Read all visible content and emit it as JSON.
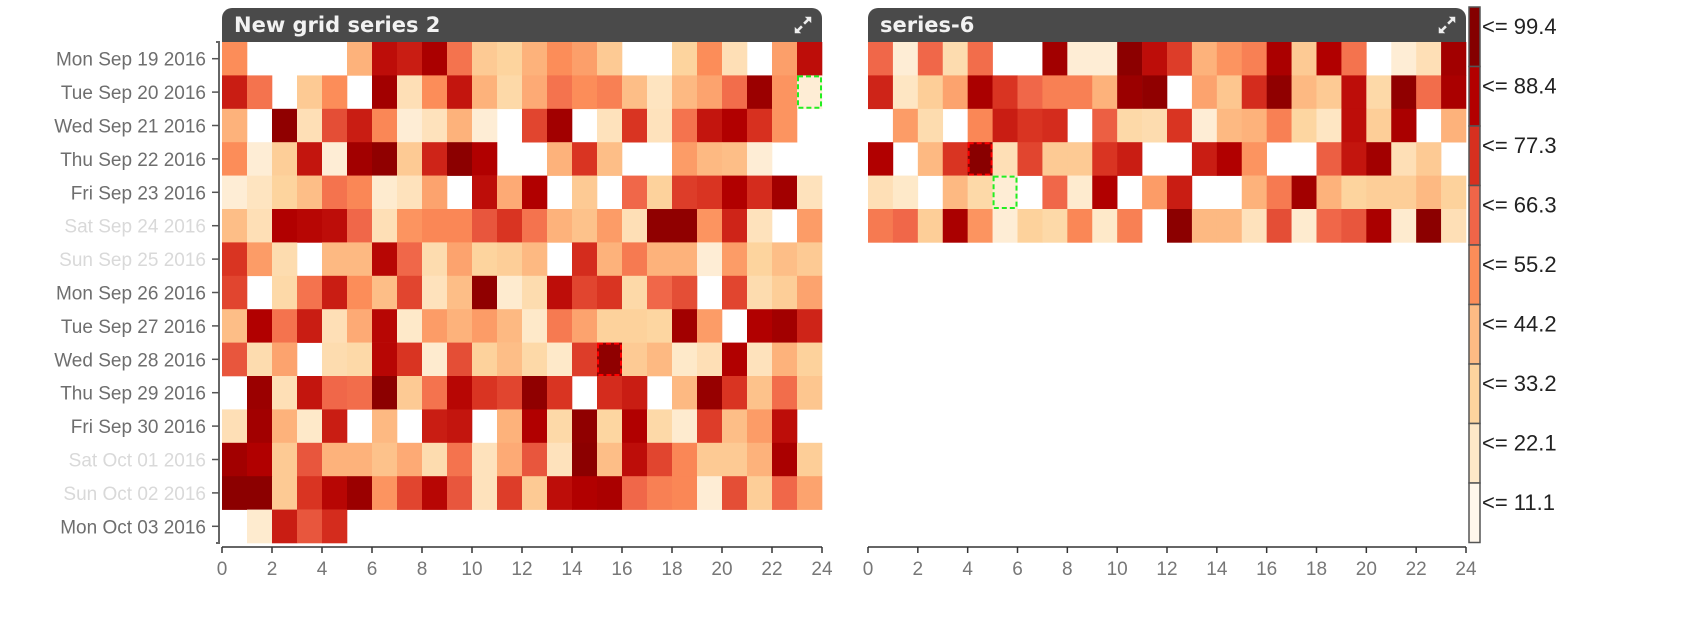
{
  "legend": {
    "entries": [
      "<= 99.4",
      "<= 88.4",
      "<= 77.3",
      "<= 66.3",
      "<= 55.2",
      "<= 44.2",
      "<= 33.2",
      "<= 22.1",
      "<= 11.1"
    ],
    "thresholds": [
      99.4,
      88.4,
      77.3,
      66.3,
      55.2,
      44.2,
      33.2,
      22.1,
      11.1
    ],
    "colors": [
      "#850000",
      "#b30000",
      "#d7301f",
      "#ef6548",
      "#fc8d59",
      "#fdbb84",
      "#fdd49e",
      "#fee8c8",
      "#fff7ec"
    ]
  },
  "chart_data": [
    {
      "type": "heatmap",
      "title": "New grid series 2",
      "xlabel": "",
      "ylabel": "",
      "xlim": [
        0,
        24
      ],
      "x_ticks": [
        "0",
        "2",
        "4",
        "6",
        "8",
        "10",
        "12",
        "14",
        "16",
        "18",
        "20",
        "22",
        "24"
      ],
      "y_categories": [
        "Mon Sep 19 2016",
        "Tue Sep 20 2016",
        "Wed Sep 21 2016",
        "Thu Sep 22 2016",
        "Fri Sep 23 2016",
        "Sat Sep 24 2016",
        "Sun Sep 25 2016",
        "Mon Sep 26 2016",
        "Tue Sep 27 2016",
        "Wed Sep 28 2016",
        "Thu Sep 29 2016",
        "Fri Sep 30 2016",
        "Sat Oct 01 2016",
        "Sun Oct 02 2016",
        "Mon Oct 03 2016"
      ],
      "y_dimmed": [
        false,
        false,
        false,
        false,
        false,
        true,
        true,
        false,
        false,
        false,
        false,
        false,
        true,
        true,
        false
      ],
      "values": [
        [
          50,
          null,
          null,
          null,
          null,
          40,
          84,
          80,
          90,
          58,
          30,
          25,
          40,
          50,
          45,
          30,
          null,
          null,
          25,
          50,
          18,
          null,
          45,
          84
        ],
        [
          80,
          58,
          null,
          30,
          50,
          null,
          92,
          18,
          50,
          82,
          40,
          22,
          42,
          58,
          50,
          54,
          36,
          15,
          38,
          44,
          60,
          94,
          48,
          8
        ],
        [
          40,
          null,
          97,
          18,
          68,
          80,
          52,
          8,
          16,
          40,
          8,
          null,
          70,
          92,
          null,
          16,
          74,
          16,
          58,
          82,
          88,
          75,
          48,
          null
        ],
        [
          50,
          8,
          28,
          82,
          8,
          92,
          97,
          30,
          78,
          98,
          88,
          null,
          null,
          40,
          74,
          36,
          null,
          null,
          46,
          38,
          36,
          8,
          null,
          null
        ],
        [
          8,
          15,
          25,
          36,
          58,
          52,
          10,
          16,
          44,
          null,
          84,
          42,
          88,
          null,
          30,
          null,
          62,
          26,
          72,
          74,
          88,
          76,
          92,
          16
        ],
        [
          36,
          18,
          88,
          86,
          84,
          62,
          18,
          48,
          52,
          52,
          66,
          74,
          58,
          40,
          34,
          46,
          18,
          97,
          97,
          48,
          78,
          16,
          null,
          46
        ],
        [
          74,
          46,
          20,
          null,
          38,
          38,
          86,
          62,
          20,
          44,
          25,
          28,
          38,
          null,
          76,
          40,
          56,
          40,
          40,
          8,
          46,
          25,
          36,
          30
        ],
        [
          70,
          null,
          22,
          58,
          80,
          50,
          36,
          70,
          16,
          36,
          97,
          10,
          20,
          84,
          70,
          74,
          22,
          62,
          68,
          null,
          70,
          20,
          28,
          44
        ],
        [
          36,
          88,
          58,
          80,
          18,
          42,
          86,
          12,
          46,
          40,
          46,
          38,
          12,
          56,
          44,
          26,
          26,
          24,
          92,
          46,
          null,
          88,
          92,
          78
        ],
        [
          66,
          20,
          44,
          null,
          20,
          22,
          86,
          74,
          10,
          68,
          26,
          36,
          22,
          12,
          72,
          97,
          30,
          38,
          12,
          18,
          88,
          16,
          40,
          26
        ],
        [
          null,
          94,
          18,
          82,
          62,
          60,
          98,
          30,
          58,
          86,
          74,
          70,
          97,
          74,
          null,
          76,
          80,
          null,
          38,
          95,
          74,
          34,
          60,
          32
        ],
        [
          18,
          92,
          40,
          12,
          80,
          null,
          38,
          null,
          80,
          82,
          null,
          40,
          88,
          22,
          97,
          24,
          88,
          22,
          10,
          72,
          36,
          46,
          84,
          null
        ],
        [
          92,
          88,
          30,
          66,
          40,
          40,
          34,
          42,
          20,
          58,
          16,
          42,
          66,
          16,
          98,
          36,
          84,
          70,
          52,
          30,
          30,
          40,
          90,
          28
        ],
        [
          98,
          98,
          30,
          74,
          86,
          94,
          48,
          70,
          86,
          66,
          16,
          72,
          30,
          84,
          88,
          90,
          62,
          54,
          52,
          8,
          68,
          28,
          62,
          44
        ],
        [
          null,
          10,
          80,
          66,
          76,
          null,
          null,
          null,
          null,
          null,
          null,
          null,
          null,
          null,
          null,
          null,
          null,
          null,
          null,
          null,
          null,
          null,
          null,
          null
        ]
      ],
      "highlight_red": {
        "row": 9,
        "col": 15
      },
      "highlight_green": {
        "row": 1,
        "col": 23
      }
    },
    {
      "type": "heatmap",
      "title": "series-6",
      "xlabel": "",
      "ylabel": "",
      "xlim": [
        0,
        24
      ],
      "x_ticks": [
        "0",
        "2",
        "4",
        "6",
        "8",
        "10",
        "12",
        "14",
        "16",
        "18",
        "20",
        "22",
        "24"
      ],
      "values": [
        [
          62,
          8,
          62,
          20,
          60,
          null,
          null,
          92,
          8,
          8,
          98,
          84,
          72,
          40,
          48,
          54,
          90,
          30,
          88,
          58,
          null,
          8,
          18,
          92
        ],
        [
          78,
          14,
          28,
          44,
          90,
          74,
          62,
          54,
          54,
          40,
          94,
          97,
          null,
          44,
          32,
          76,
          97,
          38,
          30,
          84,
          22,
          97,
          60,
          90
        ],
        [
          null,
          46,
          20,
          null,
          52,
          80,
          74,
          76,
          null,
          64,
          22,
          20,
          74,
          8,
          38,
          40,
          54,
          24,
          14,
          84,
          28,
          90,
          null,
          40
        ],
        [
          88,
          null,
          38,
          74,
          99,
          18,
          70,
          30,
          30,
          74,
          80,
          null,
          null,
          80,
          88,
          48,
          null,
          null,
          64,
          82,
          92,
          18,
          30,
          null
        ],
        [
          18,
          12,
          null,
          38,
          22,
          8,
          null,
          62,
          10,
          88,
          null,
          46,
          80,
          null,
          null,
          40,
          56,
          92,
          40,
          25,
          28,
          28,
          38,
          26
        ],
        [
          56,
          62,
          28,
          90,
          48,
          8,
          26,
          22,
          52,
          12,
          54,
          null,
          98,
          38,
          38,
          16,
          68,
          10,
          62,
          66,
          90,
          10,
          98,
          18
        ]
      ],
      "highlight_red": {
        "row": 3,
        "col": 4
      },
      "highlight_green": {
        "row": 4,
        "col": 5
      }
    }
  ]
}
